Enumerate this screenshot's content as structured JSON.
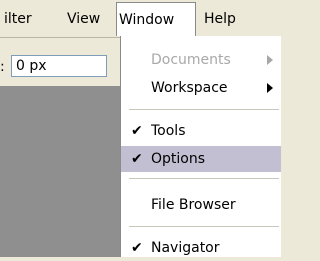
{
  "menubar": {
    "filter": "ilter",
    "view": "View",
    "window": "Window",
    "help": "Help"
  },
  "options": {
    "label": ":",
    "value": "0 px"
  },
  "window_menu": {
    "documents": "Documents",
    "workspace": "Workspace",
    "tools": "Tools",
    "options": "Options",
    "file_browser": "File Browser",
    "navigator": "Navigator",
    "check_glyph": "✔"
  }
}
